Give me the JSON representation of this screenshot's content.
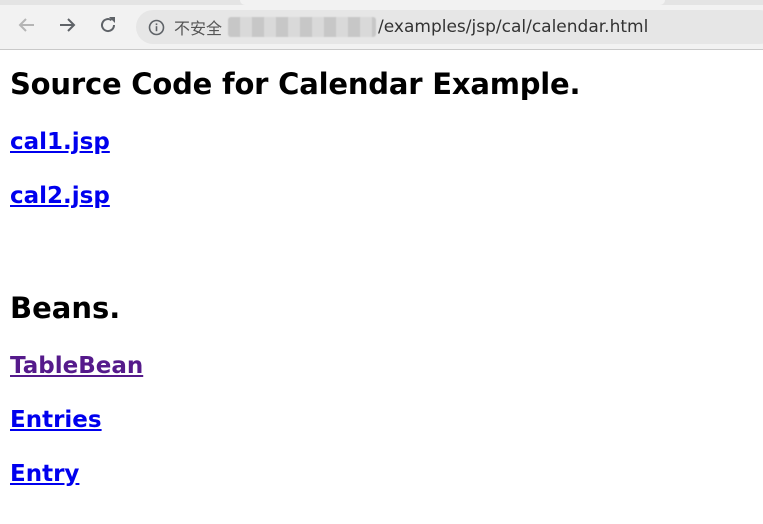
{
  "browser": {
    "security_label": "不安全",
    "url_suffix": "/examples/jsp/cal/calendar.html",
    "icons": {
      "back": "back-arrow-icon",
      "forward": "forward-arrow-icon",
      "reload": "reload-icon",
      "security": "info-icon"
    }
  },
  "page": {
    "heading": "Source Code for Calendar Example.",
    "source_links": [
      {
        "label": "cal1.jsp",
        "visited": false
      },
      {
        "label": "cal2.jsp",
        "visited": false
      }
    ],
    "beans_heading": "Beans.",
    "bean_links": [
      {
        "label": "TableBean",
        "visited": true
      },
      {
        "label": "Entries",
        "visited": false
      },
      {
        "label": "Entry",
        "visited": false
      }
    ]
  },
  "colors": {
    "link": "#0000ee",
    "visited_link": "#551a8b",
    "chrome_bg": "#f2f2f2",
    "omnibox_bg": "#e6e6e6"
  }
}
